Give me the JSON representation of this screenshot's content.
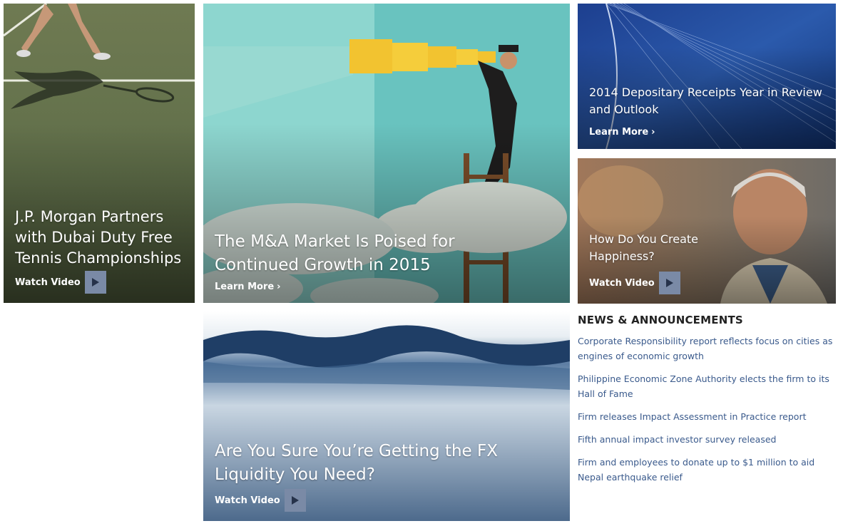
{
  "tiles": {
    "tennis": {
      "title": "J.P. Morgan Partners with Dubai Duty Free Tennis Championships",
      "cta": "Watch Video"
    },
    "ma": {
      "title": "The M&A Market Is Poised for Continued Growth in 2015",
      "cta": "Learn More"
    },
    "dr": {
      "title": "2014 Depositary Receipts Year in Review and Outlook",
      "cta": "Learn More"
    },
    "happy": {
      "title": "How Do You Create Happiness?",
      "cta": "Watch Video"
    },
    "fx": {
      "title": "Are You Sure You’re Getting the FX Liquidity You Need?",
      "cta": "Watch Video"
    }
  },
  "news": {
    "heading": "NEWS & ANNOUNCEMENTS",
    "items": [
      "Corporate Responsibility report reflects focus on cities as engines of economic growth",
      "Philippine Economic Zone Authority elects the firm to its Hall of Fame",
      "Firm releases Impact Assessment in Practice report",
      "Fifth annual impact investor survey released",
      "Firm and employees to donate up to $1 million to aid Nepal earthquake relief"
    ]
  },
  "icons": {
    "play": "play-icon",
    "chevron": "chevron-right-icon"
  },
  "colors": {
    "link": "#3a5a8c",
    "play_button": "#7a8aa6",
    "heading": "#222222"
  }
}
